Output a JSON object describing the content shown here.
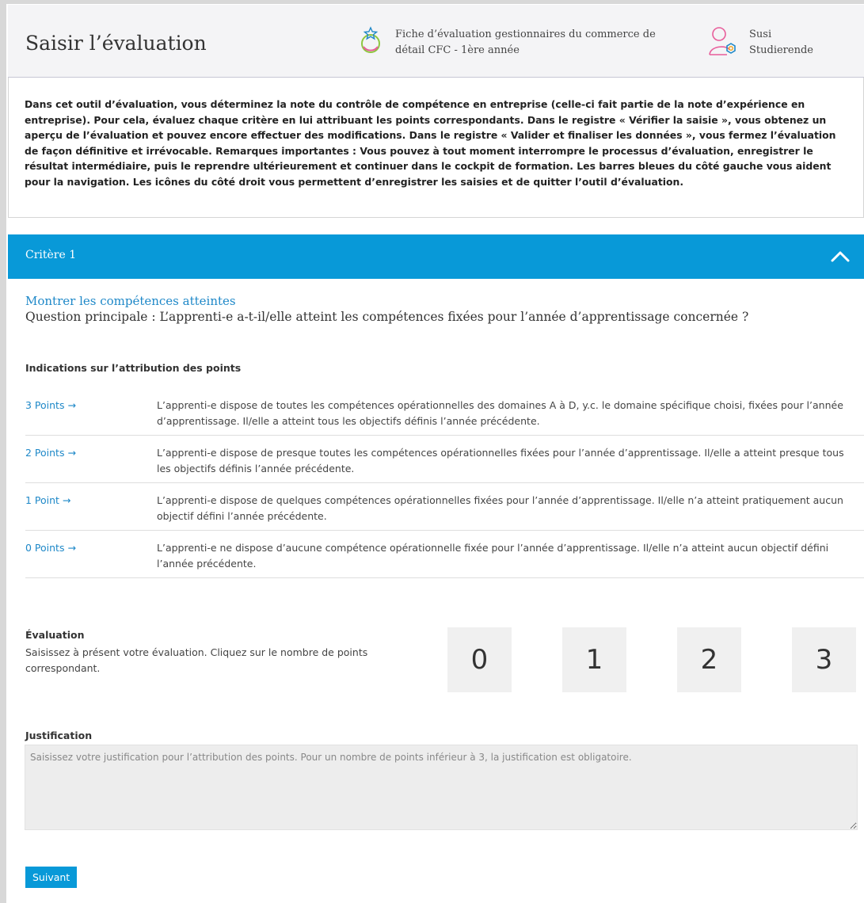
{
  "header": {
    "title": "Saisir l’évaluation",
    "sheet_name": "Fiche d’évaluation gestionnaires du commerce de détail CFC - 1ère année",
    "sheet_icon": "medal-star-icon",
    "user_first_name": "Susi",
    "user_last_name": "Studierende",
    "user_icon": "user-settings-icon"
  },
  "intro": {
    "text": "Dans cet outil d’évaluation, vous déterminez la note du contrôle de compétence en entreprise (celle-ci fait partie de la note d’expérience en entreprise). Pour cela, évaluez chaque critère en lui attribuant les points correspondants. Dans le registre « Vérifier la saisie », vous obtenez un aperçu de l’évaluation et pouvez encore effectuer des modifications. Dans le registre « Valider et finaliser les données », vous fermez l’évaluation de façon définitive et irrévocable. Remarques importantes : Vous pouvez à tout moment interrompre le processus d’évaluation, enregistrer le résultat intermédiaire, puis le reprendre ultérieurement et continuer dans le cockpit de formation. Les barres bleues du côté gauche vous aident pour la navigation. Les icônes du côté droit vous permettent d’enregistrer les saisies et de quitter l’outil d’évaluation."
  },
  "criterion": {
    "title": "Critère 1",
    "toggle_icon": "chevron-up-icon",
    "competence_heading": "Montrer les compétences atteintes",
    "question": "Question principale : L’apprenti-e a-t-il/elle atteint les compétences fixées pour l’année d’apprentissage concernée ?"
  },
  "points": {
    "title": "Indications sur l’attribution des points",
    "rows": [
      {
        "label": "3 Points →",
        "description": "L’apprenti-e dispose de toutes les compétences opérationnelles des domaines A à D, y.c. le domaine spécifique choisi, fixées pour l’année d’apprentissage. Il/elle a atteint tous les objectifs définis l’année précédente."
      },
      {
        "label": "2 Points →",
        "description": "L’apprenti-e dispose de presque toutes les compétences opérationnelles fixées pour l’année d’apprentissage. Il/elle a atteint presque tous les objectifs définis l’année précédente."
      },
      {
        "label": "1 Point →",
        "description": "L’apprenti-e dispose de quelques compétences opérationnelles fixées pour l’année d’apprentissage. Il/elle n’a atteint pratiquement aucun objectif défini l’année précédente."
      },
      {
        "label": "0 Points →",
        "description": "L’apprenti-e ne dispose d’aucune compétence opérationnelle fixée pour l’année d’apprentissage. Il/elle n’a atteint aucun objectif défini l’année précédente."
      }
    ]
  },
  "evaluation": {
    "title": "Évaluation",
    "description": "Saisissez à présent votre évaluation. Cliquez sur le nombre de points correspondant.",
    "options": [
      "0",
      "1",
      "2",
      "3"
    ]
  },
  "justification": {
    "title": "Justification",
    "value": "",
    "placeholder": "Saisissez votre justification pour l’attribution des points. Pour un nombre de points inférieur à 3, la justification est obligatoire."
  },
  "actions": {
    "next_label": "Suivant"
  },
  "colors": {
    "accent": "#0899d8",
    "link": "#1e88c8",
    "header_bg": "#f4f4f6",
    "score_bg": "#f0f0f0"
  }
}
